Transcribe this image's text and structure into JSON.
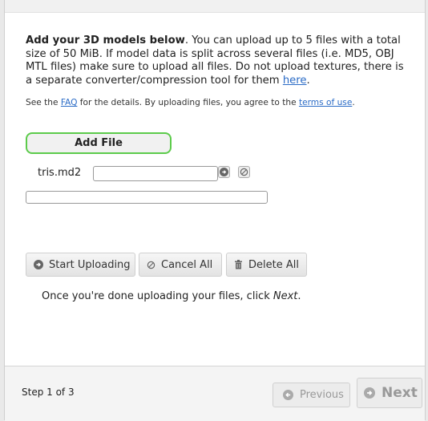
{
  "intro": {
    "bold": "Add your 3D models below",
    "text1": ". You can upload up to 5 files with a total size of 50 MiB. If model data is split across several files (i.e. MD5, OBJ MTL files) make sure to upload all files. Do not upload textures, there is a separate converter/compression tool for them ",
    "link": "here",
    "end": "."
  },
  "legal": {
    "pre": "See the ",
    "faq": "FAQ",
    "mid": " for the details. By uploading files, you agree to the ",
    "terms": "terms of use",
    "end": "."
  },
  "add_file_label": "Add File",
  "file": {
    "name": "tris.md2",
    "value": ""
  },
  "upload_progress": 0,
  "buttons": {
    "start": "Start Uploading",
    "cancel": "Cancel All",
    "delete": "Delete All"
  },
  "done": {
    "pre": "Once you're done uploading your files, click ",
    "em": "Next",
    "end": "."
  },
  "footer": {
    "step": "Step 1 of 3",
    "previous": "Previous",
    "next": "Next"
  },
  "colors": {
    "accent_green": "#5ccb4b",
    "link_blue": "#2a6bc6"
  },
  "icons": [
    "arrow-right-circle-icon",
    "cancel-circle-icon",
    "trash-icon",
    "arrow-left-circle-icon"
  ]
}
